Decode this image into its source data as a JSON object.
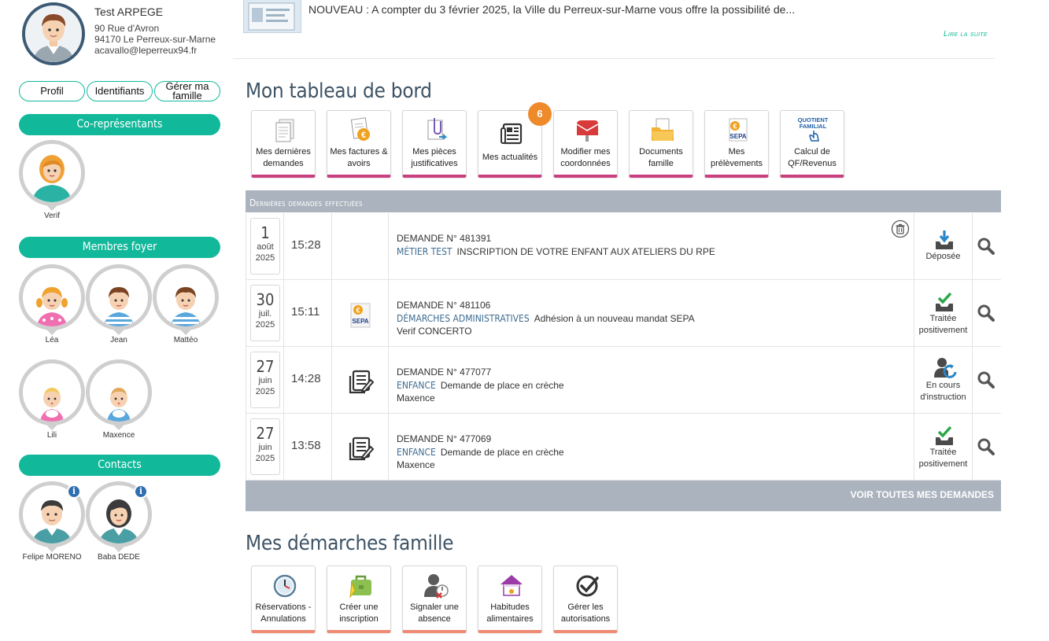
{
  "user": {
    "name": "Test ARPEGE",
    "address1": "90 Rue d'Avron",
    "address2": "94170 Le Perreux-sur-Marne",
    "email": "acavallo@leperreux94.fr"
  },
  "profile_buttons": {
    "profile": "Profil",
    "credentials": "Identifiants",
    "family": "Gérer ma famille"
  },
  "sections": {
    "coreps": "Co-représentants",
    "household": "Membres foyer",
    "contacts": "Contacts"
  },
  "coreps": [
    {
      "name": "Verif"
    }
  ],
  "household": [
    {
      "name": "Léa"
    },
    {
      "name": "Jean"
    },
    {
      "name": "Mattéo"
    },
    {
      "name": "Lili"
    },
    {
      "name": "Maxence"
    }
  ],
  "contacts": [
    {
      "name": "Felipe MORENO",
      "info": "i"
    },
    {
      "name": "Baba DEDE",
      "info": "i"
    }
  ],
  "news": {
    "text": "NOUVEAU  : A compter du 3 février 2025, la Ville du Perreux-sur-Marne vous offre la possibilité de...",
    "read_more": "Lire la suite"
  },
  "dashboard": {
    "title": "Mon tableau de bord",
    "badge": "6",
    "tiles": [
      {
        "line1": "Mes dernières",
        "line2": "demandes",
        "icon": "documents-icon"
      },
      {
        "line1": "Mes factures &",
        "line2": "avoirs",
        "icon": "invoice-euro-icon"
      },
      {
        "line1": "Mes pièces",
        "line2": "justificatives",
        "icon": "attachment-icon"
      },
      {
        "line1": "Mes actualités",
        "line2": "",
        "icon": "news-icon"
      },
      {
        "line1": "Modifier mes",
        "line2": "coordonnées",
        "icon": "mailbox-icon"
      },
      {
        "line1": "Documents",
        "line2": "famille",
        "icon": "folder-icon"
      },
      {
        "line1": "Mes",
        "line2": "prélèvements",
        "icon": "sepa-icon"
      },
      {
        "line1": "Calcul de",
        "line2": "QF/Revenus",
        "icon": "quotient-icon"
      }
    ],
    "sepa_label": "SEPA",
    "quotient_label1": "QUOTIENT",
    "quotient_label2": "FAMILIAL"
  },
  "requests": {
    "header": "Dernières demandes effectuées",
    "footer": "VOIR TOUTES MES DEMANDES",
    "rows": [
      {
        "day": "1",
        "month": "août",
        "year": "2025",
        "time": "15:28",
        "icon": "",
        "number": "DEMANDE N° 481391",
        "category": "MÉTIER TEST",
        "label": "INSCRIPTION DE VOTRE ENFANT AUX ATELIERS DU RPE",
        "sub": "",
        "status1": "Déposée",
        "status2": "",
        "status_icon": "upload-tray-icon",
        "deletable": true
      },
      {
        "day": "30",
        "month": "juil.",
        "year": "2025",
        "time": "15:11",
        "icon": "sepa-icon",
        "number": "DEMANDE N° 481106",
        "category": "DÉMARCHES ADMINISTRATIVES",
        "label": "Adhésion à un nouveau mandat SEPA",
        "sub": "Verif CONCERTO",
        "status1": "Traitée",
        "status2": "positivement",
        "status_icon": "check-tray-icon",
        "deletable": false
      },
      {
        "day": "27",
        "month": "juin",
        "year": "2025",
        "time": "14:28",
        "icon": "form-icon",
        "number": "DEMANDE N° 477077",
        "category": "ENFANCE",
        "label": "Demande de place en crèche",
        "sub": "Maxence",
        "status1": "En cours",
        "status2": "d'instruction",
        "status_icon": "user-refresh-icon",
        "deletable": false
      },
      {
        "day": "27",
        "month": "juin",
        "year": "2025",
        "time": "13:58",
        "icon": "form-icon",
        "number": "DEMANDE N° 477069",
        "category": "ENFANCE",
        "label": "Demande de place en crèche",
        "sub": "Maxence",
        "status1": "Traitée",
        "status2": "positivement",
        "status_icon": "check-tray-icon",
        "deletable": false
      }
    ]
  },
  "family": {
    "title": "Mes démarches famille",
    "tiles": [
      {
        "line1": "Réservations -",
        "line2": "Annulations",
        "icon": "clock-icon"
      },
      {
        "line1": "Créer une",
        "line2": "inscription",
        "icon": "briefcase-icon"
      },
      {
        "line1": "Signaler une",
        "line2": "absence",
        "icon": "absence-icon"
      },
      {
        "line1": "Habitudes",
        "line2": "alimentaires",
        "icon": "restaurant-icon"
      },
      {
        "line1": "Gérer les",
        "line2": "autorisations",
        "icon": "checkmark-icon"
      }
    ]
  }
}
